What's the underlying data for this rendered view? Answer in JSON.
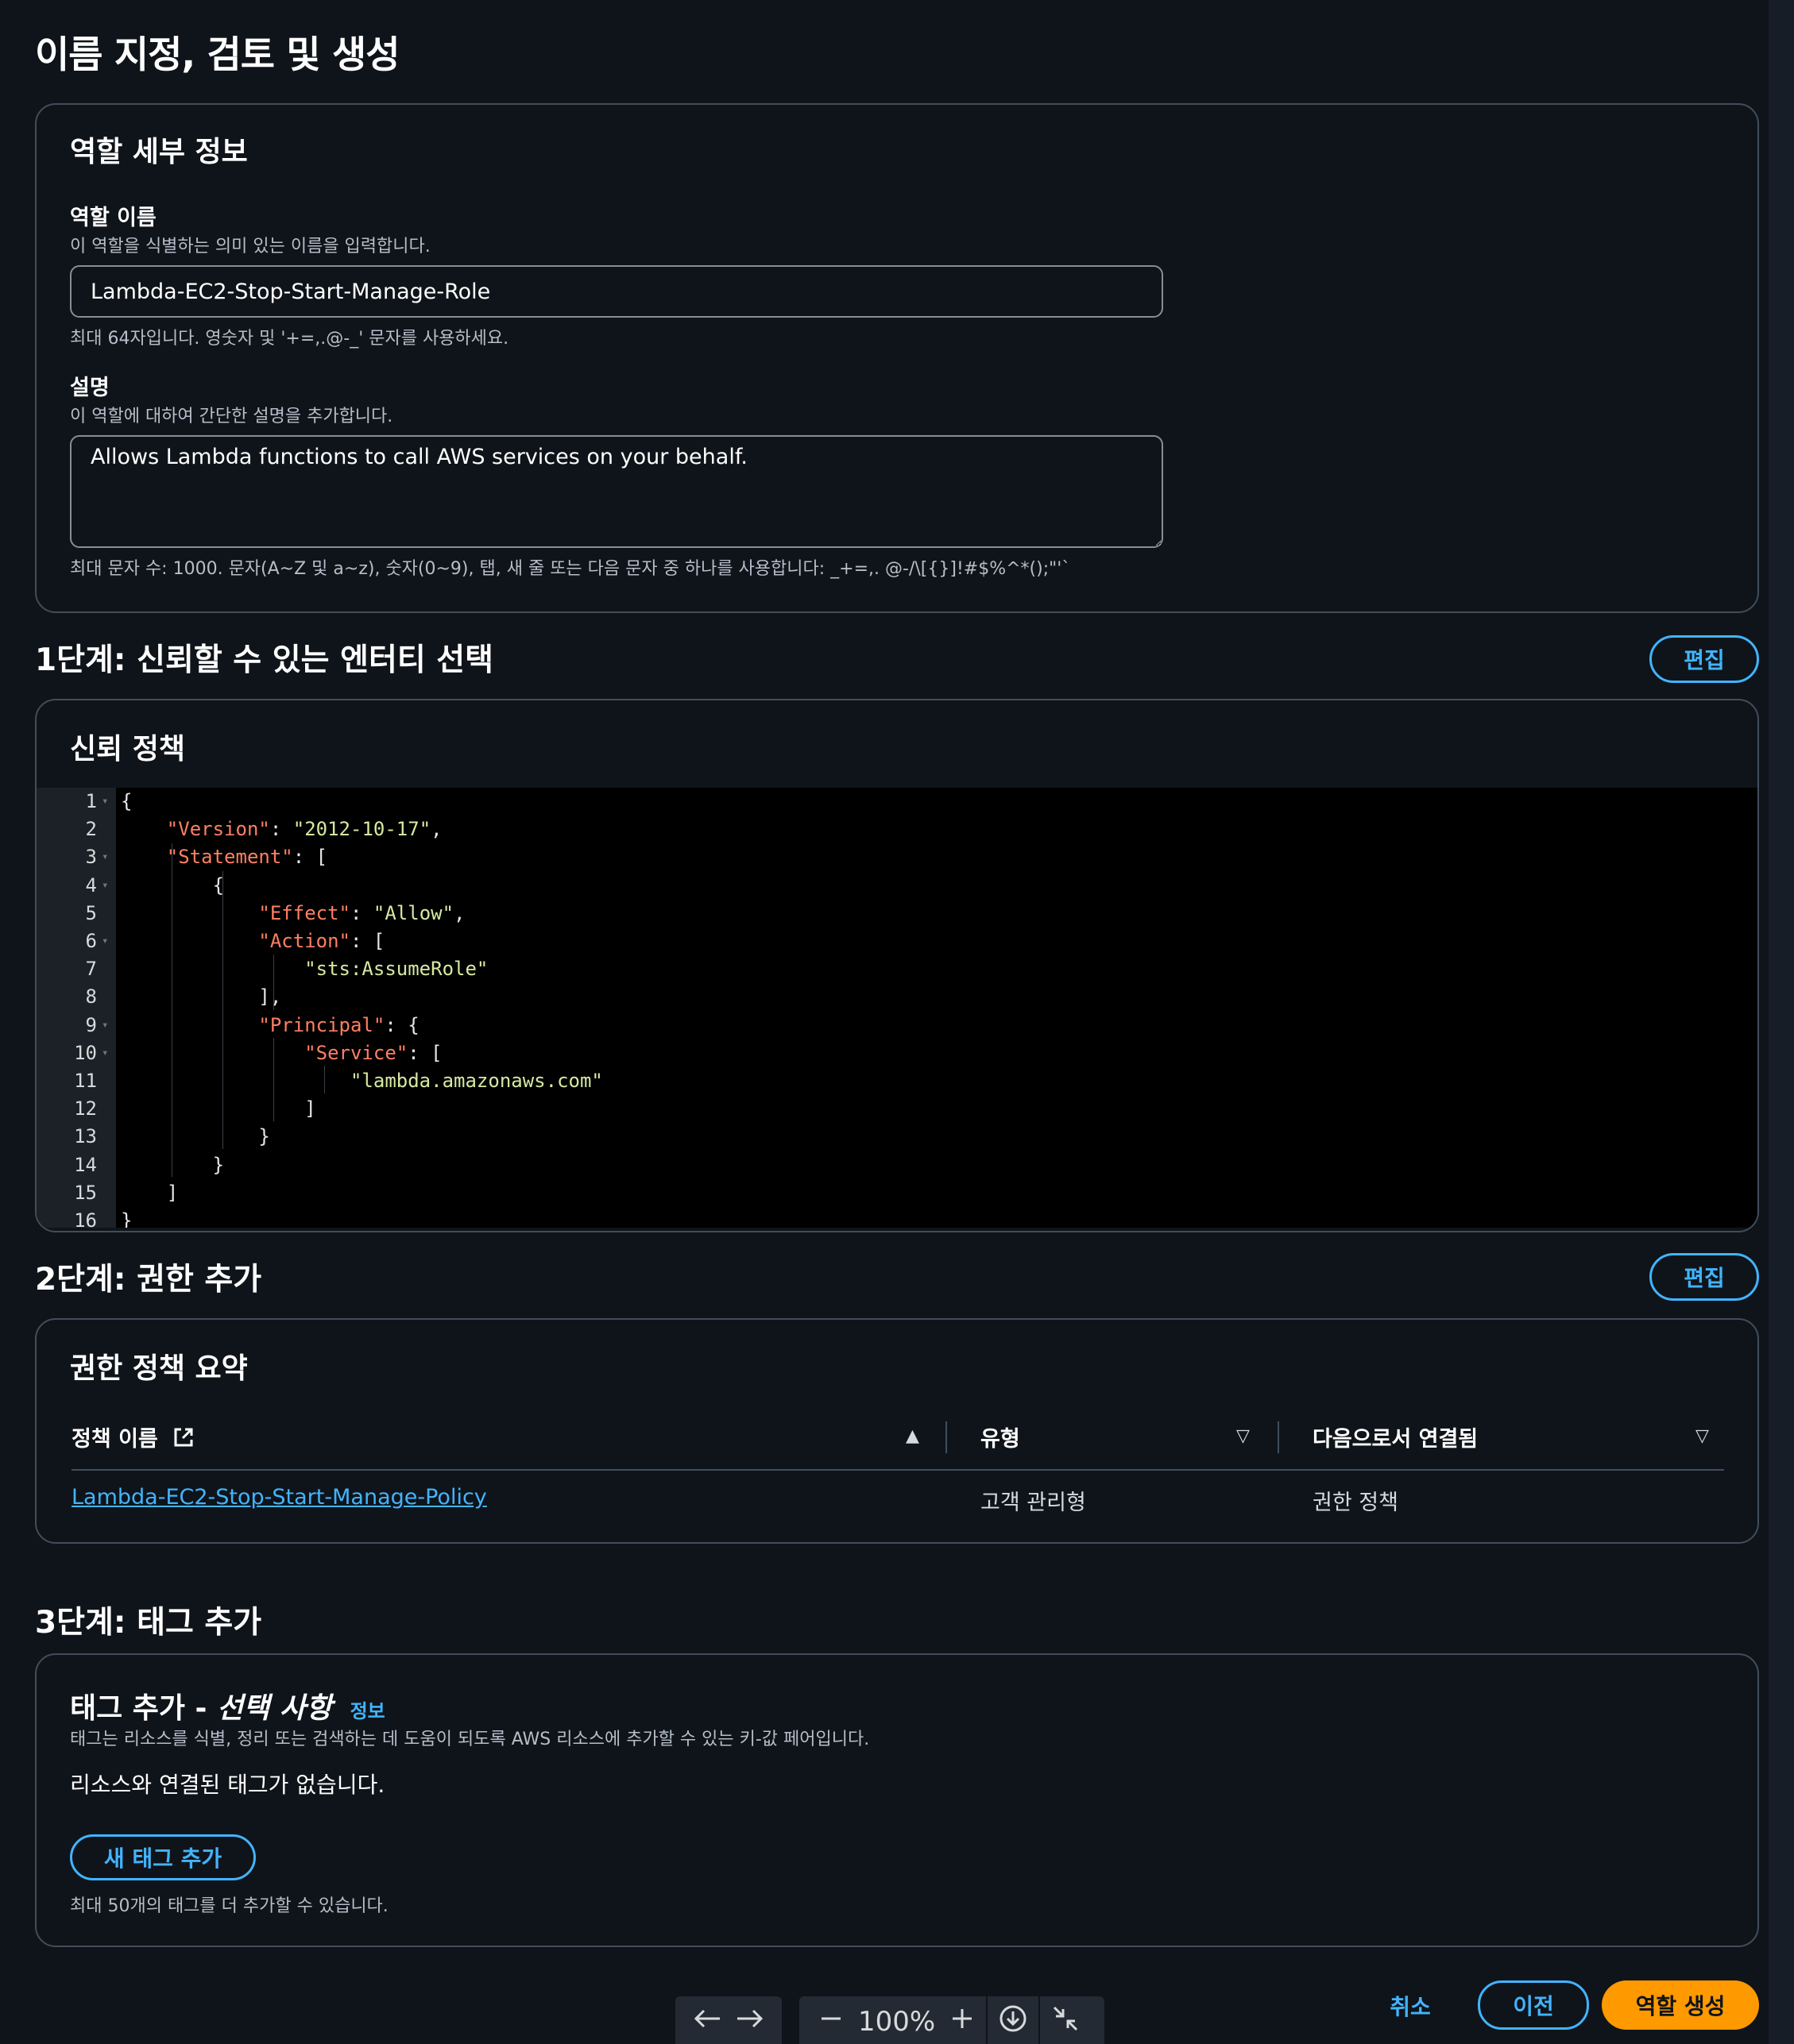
{
  "page": {
    "title": "이름 지정, 검토 및 생성"
  },
  "role_details": {
    "title": "역할 세부 정보",
    "name_label": "역할 이름",
    "name_desc": "이 역할을 식별하는 의미 있는 이름을 입력합니다.",
    "name_value": "Lambda-EC2-Stop-Start-Manage-Role",
    "name_hint": "최대 64자입니다. 영숫자 및 '+=,.@-_' 문자를 사용하세요.",
    "desc_label": "설명",
    "desc_desc": "이 역할에 대하여 간단한 설명을 추가합니다.",
    "desc_value": "Allows Lambda functions to call AWS services on your behalf.",
    "desc_hint": "최대 문자 수: 1000. 문자(A~Z 및 a~z), 숫자(0~9), 탭, 새 줄 또는 다음 문자 중 하나를 사용합니다: _+=,. @-/\\[{}]!#$%^*();\"'`"
  },
  "step1": {
    "title": "1단계: 신뢰할 수 있는 엔터티 선택",
    "edit_label": "편집",
    "card_title": "신뢰 정책",
    "code_lines": [
      "{",
      "    \"Version\": \"2012-10-17\",",
      "    \"Statement\": [",
      "        {",
      "            \"Effect\": \"Allow\",",
      "            \"Action\": [",
      "                \"sts:AssumeRole\"",
      "            ],",
      "            \"Principal\": {",
      "                \"Service\": [",
      "                    \"lambda.amazonaws.com\"",
      "                ]",
      "            }",
      "        }",
      "    ]",
      "}"
    ]
  },
  "step2": {
    "title": "2단계: 권한 추가",
    "edit_label": "편집",
    "card_title": "권한 정책 요약",
    "columns": [
      "정책 이름",
      "유형",
      "다음으로서 연결됨"
    ],
    "rows": [
      {
        "name": "Lambda-EC2-Stop-Start-Manage-Policy",
        "type": "고객 관리형",
        "attached_as": "권한 정책"
      }
    ]
  },
  "step3": {
    "title": "3단계: 태그 추가",
    "card_title_main": "태그 추가 - ",
    "card_title_optional": "선택 사항",
    "info_label": "정보",
    "desc": "태그는 리소스를 식별, 정리 또는 검색하는 데 도움이 되도록 AWS 리소스에 추가할 수 있는 키-값 페어입니다.",
    "empty_text": "리소스와 연결된 태그가 없습니다.",
    "add_tag_label": "새 태그 추가",
    "limit_hint": "최대 50개의 태그를 더 추가할 수 있습니다."
  },
  "footer": {
    "cancel_label": "취소",
    "prev_label": "이전",
    "create_label": "역할 생성"
  },
  "viewer_toolbar": {
    "zoom": "100%",
    "icons": [
      "arrow-left-icon",
      "arrow-right-icon",
      "zoom-out-icon",
      "zoom-in-icon",
      "download-icon",
      "collapse-icon"
    ]
  },
  "colors": {
    "background": "#0f141a",
    "accent": "#42b4ff",
    "primary_button": "#ff9900",
    "border": "#414d5c"
  }
}
